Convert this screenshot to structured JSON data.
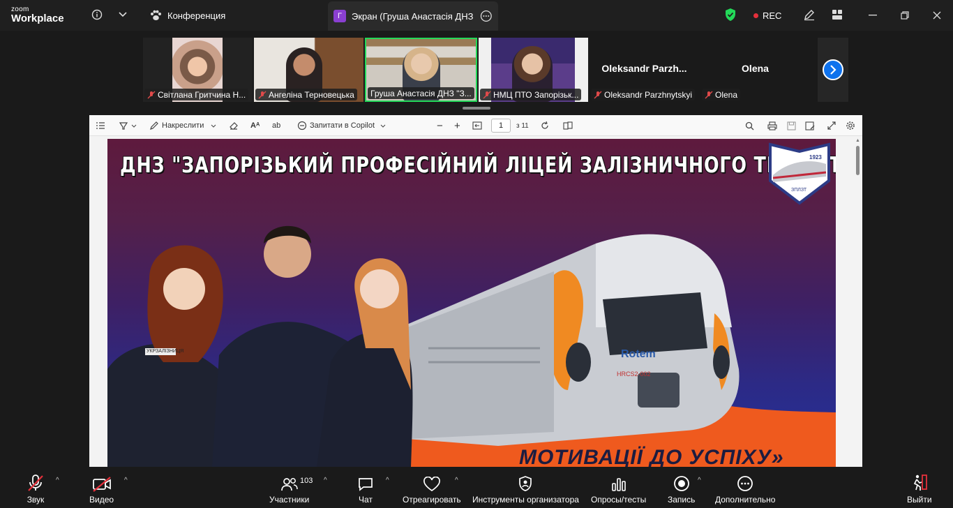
{
  "app": {
    "logo_line1": "zoom",
    "logo_line2": "Workplace"
  },
  "tabs": {
    "conference_label": "Конференция",
    "screen_badge": "Г",
    "screen_label": "Экран (Груша Анастасія ДНЗ \"Запорізький професійний ліцей залізничного транспорту\")"
  },
  "status": {
    "rec_label": "REC"
  },
  "participants": [
    {
      "name": "Світлана Гритчина Н...",
      "muted": true
    },
    {
      "name": "Ангеліна Терновецька",
      "muted": true
    },
    {
      "name": "Груша Анастасія ДНЗ \"З...",
      "muted": false,
      "active": true
    },
    {
      "name": "НМЦ ПТО Запорізьк...",
      "muted": true
    },
    {
      "name": "Oleksandr Parzhnytskyi",
      "display": "Oleksandr  Parzh...",
      "muted": true
    },
    {
      "name": "Olena",
      "display": "Olena",
      "muted": true
    }
  ],
  "viewer": {
    "draw_label": "Накреслити",
    "copilot_label": "Запитати в Copilot",
    "page_current": "1",
    "page_total": "з 11",
    "slide_title": "ДНЗ \"ЗАПОРІЗЬКИЙ ПРОФЕСІЙНИЙ ЛІЦЕЙ ЗАЛІЗНИЧНОГО ТРАНСПОРТУ\"",
    "slide_bottom_text": "МОТИВАЦІЇ ДО УСПІХУ»",
    "emblem_year": "1923",
    "emblem_abbr": "ЗПЛЗТ",
    "train_brand": "Rotem",
    "train_code": "HRCS2-002",
    "patch_text": "УКРЗАЛІЗНИЦЯ"
  },
  "controls": {
    "audio": "Звук",
    "video": "Видео",
    "participants": "Участники",
    "participants_count": "103",
    "chat": "Чат",
    "react": "Отреагировать",
    "host_tools": "Инструменты организатора",
    "polls": "Опросы/тесты",
    "record": "Запись",
    "more": "Дополнительно",
    "leave": "Выйти"
  },
  "colors": {
    "accent": "#0e72ed",
    "active_border": "#23d959",
    "rec": "#e5303b",
    "shield": "#23d959"
  }
}
